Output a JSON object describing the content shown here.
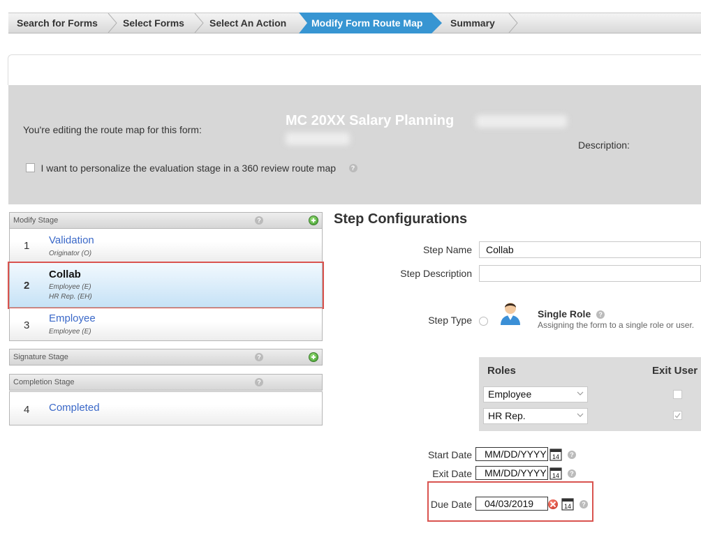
{
  "wizard": {
    "steps": [
      "Search for Forms",
      "Select Forms",
      "Select An Action",
      "Modify Form Route Map",
      "Summary"
    ],
    "active_index": 3
  },
  "header": {
    "editing_label": "You're editing the route map for this form:",
    "form_title": "MC 20XX Salary Planning",
    "description_label": "Description:",
    "personalize_label": "I want to personalize the evaluation stage in a 360 review route map"
  },
  "stages": {
    "modify": {
      "label": "Modify Stage",
      "steps": [
        {
          "num": "1",
          "name": "Validation",
          "roles": [
            "Originator (O)"
          ]
        },
        {
          "num": "2",
          "name": "Collab",
          "roles": [
            "Employee (E)",
            "HR Rep. (EH)"
          ]
        },
        {
          "num": "3",
          "name": "Employee",
          "roles": [
            "Employee (E)"
          ]
        }
      ]
    },
    "signature": {
      "label": "Signature Stage"
    },
    "completion": {
      "label": "Completion Stage",
      "steps": [
        {
          "num": "4",
          "name": "Completed"
        }
      ]
    }
  },
  "config": {
    "title": "Step Configurations",
    "step_name_label": "Step Name",
    "step_name_value": "Collab",
    "step_desc_label": "Step Description",
    "step_desc_value": "",
    "step_type_label": "Step Type",
    "single_role_title": "Single Role",
    "single_role_desc": "Assigning the form to a single role or user.",
    "roles_header": "Roles",
    "exit_user_header": "Exit User",
    "roles": [
      {
        "value": "Employee",
        "exit_user": false
      },
      {
        "value": "HR Rep.",
        "exit_user": true
      }
    ],
    "start_date_label": "Start Date",
    "start_date_placeholder": "MM/DD/YYYY",
    "exit_date_label": "Exit Date",
    "exit_date_placeholder": "MM/DD/YYYY",
    "due_date_label": "Due Date",
    "due_date_value": "04/03/2019",
    "calendar_day": "14"
  },
  "colors": {
    "accent": "#3795d2",
    "link": "#3a68c8",
    "highlight": "#d9534f",
    "header_band": "#d7d7d7"
  },
  "icons": [
    "help-icon",
    "add-icon",
    "avatar-icon",
    "calendar-icon",
    "clear-icon",
    "chevron-down-icon"
  ]
}
